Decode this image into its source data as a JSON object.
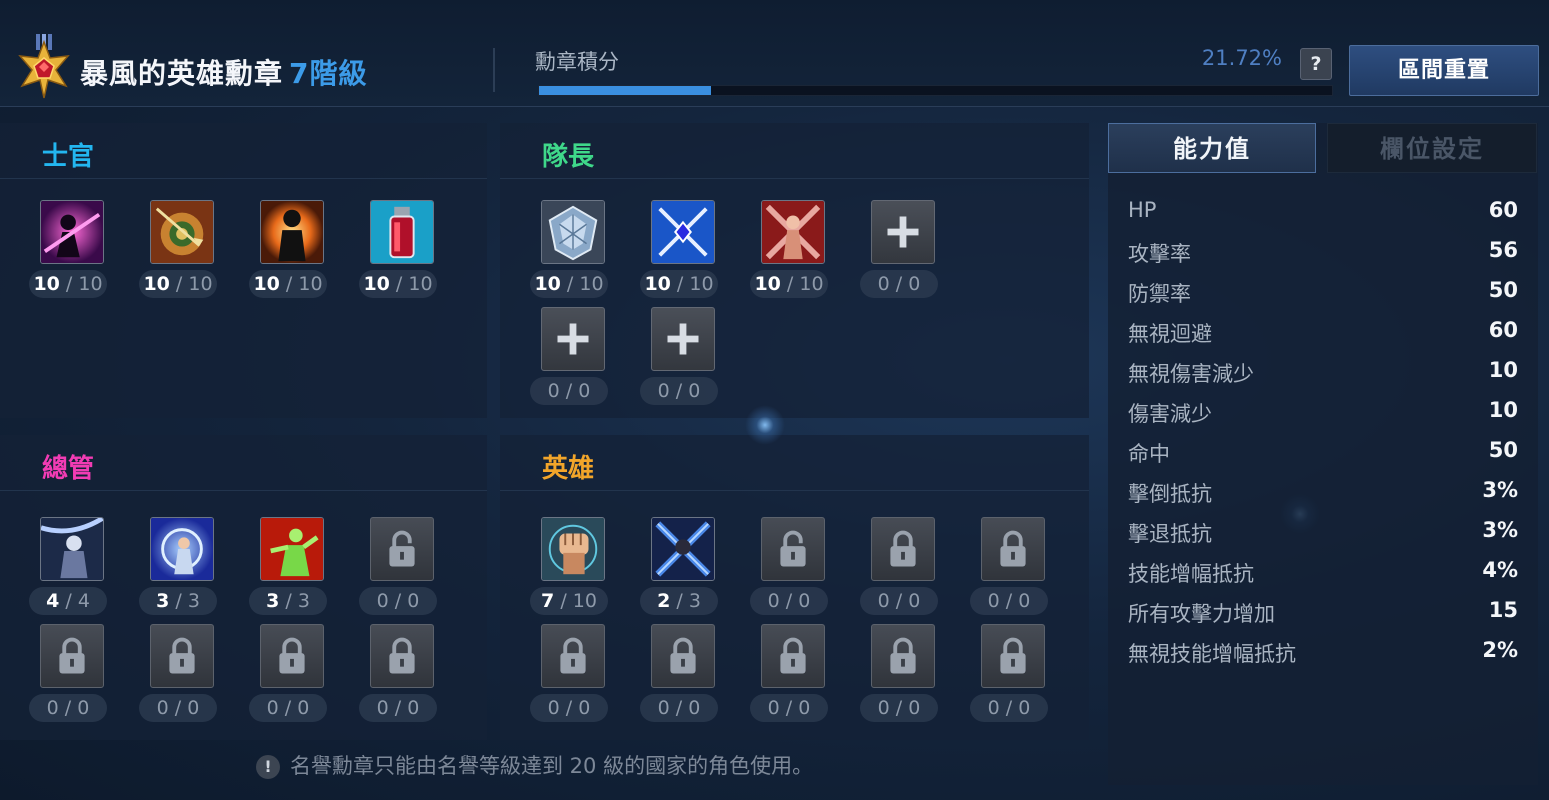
{
  "header": {
    "title": "暴風的英雄勳章",
    "grade": "7階級",
    "points_label": "勳章積分",
    "progress_text": "21.72%",
    "progress": 0.2172,
    "help_label": "?",
    "reset_button": "區間重置"
  },
  "sections": {
    "officer": {
      "title": "士官",
      "color": "#23b6f0",
      "slots": [
        {
          "cur": "10",
          "max": "10",
          "icon": "dark-figure-slash-icon"
        },
        {
          "cur": "10",
          "max": "10",
          "icon": "shield-arrow-icon"
        },
        {
          "cur": "10",
          "max": "10",
          "icon": "silhouette-flame-icon"
        },
        {
          "cur": "10",
          "max": "10",
          "icon": "red-potion-icon"
        }
      ]
    },
    "captain": {
      "title": "隊長",
      "color": "#3fd88a",
      "slots": [
        {
          "cur": "10",
          "max": "10",
          "icon": "crystal-shield-icon"
        },
        {
          "cur": "10",
          "max": "10",
          "icon": "crossed-swords-gem-icon"
        },
        {
          "cur": "10",
          "max": "10",
          "icon": "warrior-strike-icon"
        },
        {
          "cur": "0",
          "max": "0",
          "icon": "plus-icon"
        },
        {
          "cur": "0",
          "max": "0",
          "icon": "plus-icon"
        },
        {
          "cur": "0",
          "max": "0",
          "icon": "plus-icon"
        }
      ]
    },
    "manager": {
      "title": "總管",
      "color": "#f23cb4",
      "slots": [
        {
          "cur": "4",
          "max": "4",
          "icon": "dark-warrior-icon"
        },
        {
          "cur": "3",
          "max": "3",
          "icon": "blue-vortex-icon"
        },
        {
          "cur": "3",
          "max": "3",
          "icon": "green-fighter-icon"
        },
        {
          "cur": "0",
          "max": "0",
          "icon": "lock-open-icon"
        },
        {
          "cur": "0",
          "max": "0",
          "icon": "lock-icon"
        },
        {
          "cur": "0",
          "max": "0",
          "icon": "lock-icon"
        },
        {
          "cur": "0",
          "max": "0",
          "icon": "lock-icon"
        },
        {
          "cur": "0",
          "max": "0",
          "icon": "lock-icon"
        }
      ]
    },
    "hero": {
      "title": "英雄",
      "color": "#f2a52a",
      "slots": [
        {
          "cur": "7",
          "max": "10",
          "icon": "fist-icon"
        },
        {
          "cur": "2",
          "max": "3",
          "icon": "dark-cross-icon"
        },
        {
          "cur": "0",
          "max": "0",
          "icon": "lock-open-icon"
        },
        {
          "cur": "0",
          "max": "0",
          "icon": "lock-icon"
        },
        {
          "cur": "0",
          "max": "0",
          "icon": "lock-icon"
        },
        {
          "cur": "0",
          "max": "0",
          "icon": "lock-icon"
        },
        {
          "cur": "0",
          "max": "0",
          "icon": "lock-icon"
        },
        {
          "cur": "0",
          "max": "0",
          "icon": "lock-icon"
        },
        {
          "cur": "0",
          "max": "0",
          "icon": "lock-icon"
        },
        {
          "cur": "0",
          "max": "0",
          "icon": "lock-icon"
        }
      ]
    }
  },
  "count_separator": "/",
  "stats": {
    "tab_active": "能力值",
    "tab_inactive": "欄位設定",
    "rows": [
      {
        "name": "HP",
        "value": "60"
      },
      {
        "name": "攻擊率",
        "value": "56"
      },
      {
        "name": "防禦率",
        "value": "50"
      },
      {
        "name": "無視迴避",
        "value": "60"
      },
      {
        "name": "無視傷害減少",
        "value": "10"
      },
      {
        "name": "傷害減少",
        "value": "10"
      },
      {
        "name": "命中",
        "value": "50"
      },
      {
        "name": "擊倒抵抗",
        "value": "3%"
      },
      {
        "name": "擊退抵抗",
        "value": "3%"
      },
      {
        "name": "技能增幅抵抗",
        "value": "4%"
      },
      {
        "name": "所有攻擊力增加",
        "value": "15"
      },
      {
        "name": "無視技能增幅抵抗",
        "value": "2%"
      }
    ]
  },
  "notice": {
    "icon": "!",
    "text": "名譽勳章只能由名譽等級達到 20 級的國家的角色使用。"
  }
}
